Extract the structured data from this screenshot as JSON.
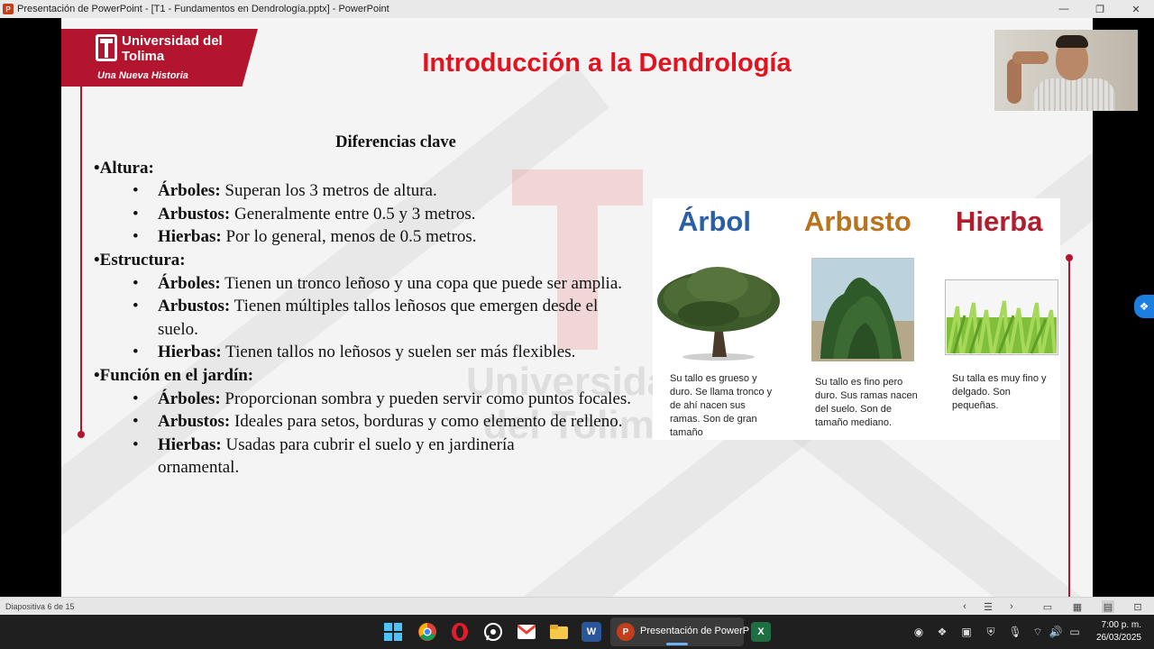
{
  "window": {
    "title": "Presentación de PowerPoint - [T1 - Fundamentos en Dendrología.pptx] - PowerPoint",
    "app_icon_label": "P",
    "minimize": "—",
    "maximize": "❐",
    "close": "✕"
  },
  "slide": {
    "logo_name": "Universidad del Tolima",
    "logo_tagline": "Una Nueva Historia",
    "title": "Introducción a la Dendrología",
    "watermark_text": "Universidad del Tolima",
    "heading": "Diferencias clave",
    "sections": [
      {
        "title": "•Altura:",
        "items": [
          {
            "term": "Árboles:",
            "text": " Superan los 3 metros de altura."
          },
          {
            "term": "Arbustos:",
            "text": " Generalmente entre 0.5 y 3 metros."
          },
          {
            "term": "Hierbas:",
            "text": " Por lo general, menos de 0.5 metros."
          }
        ]
      },
      {
        "title": "•Estructura:",
        "items": [
          {
            "term": "Árboles:",
            "text": " Tienen un tronco leñoso y una copa que puede ser amplia."
          },
          {
            "term": "Arbustos:",
            "text": " Tienen múltiples tallos leñosos que emergen desde el suelo."
          },
          {
            "term": "Hierbas:",
            "text": " Tienen tallos no leñosos y suelen ser más flexibles."
          }
        ]
      },
      {
        "title": "•Función en el jardín:",
        "items": [
          {
            "term": "Árboles:",
            "text": " Proporcionan sombra y pueden servir como puntos focales."
          },
          {
            "term": "Arbustos:",
            "text": " Ideales para setos, borduras y como elemento de relleno."
          },
          {
            "term": "Hierbas:",
            "text": " Usadas para cubrir el suelo y en jardinería ornamental."
          }
        ]
      }
    ],
    "comparison": {
      "arbol": {
        "label": "Árbol",
        "color": "#2a5fa8",
        "caption": "Su tallo es grueso y duro. Se llama tronco y de ahí nacen sus ramas. Son de gran tamaño"
      },
      "arbusto": {
        "label": "Arbusto",
        "color": "#b8731e",
        "caption": "Su tallo es fino pero duro. Sus ramas nacen del suelo. Son de tamaño mediano."
      },
      "hierba": {
        "label": "Hierba",
        "color": "#b01e2e",
        "caption": "Su talla es muy fino y delgado. Son pequeñas."
      }
    }
  },
  "statusbar": {
    "slide_number": "Diapositiva 6 de 15"
  },
  "taskbar": {
    "powerpoint_label": "Presentación de PowerP",
    "time": "7:00 p. m.",
    "date": "26/03/2025"
  },
  "colors": {
    "brand_red": "#b3142e",
    "title_red": "#e0131f"
  }
}
